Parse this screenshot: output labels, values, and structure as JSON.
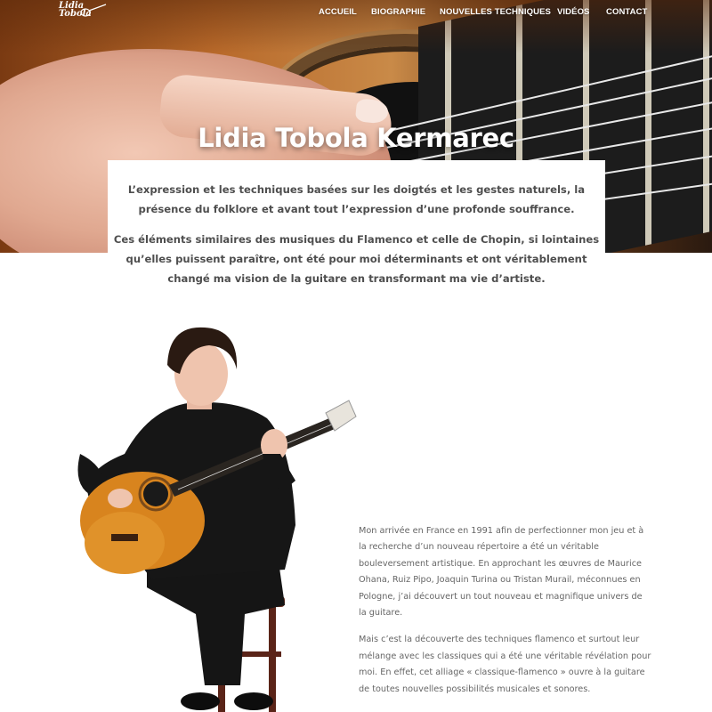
{
  "logo": {
    "line1": "Lidia",
    "line2": "Tobola"
  },
  "nav": {
    "items": [
      {
        "label": "ACCUEIL"
      },
      {
        "label": "BIOGRAPHIE"
      },
      {
        "label": "NOUVELLES TECHNIQUES"
      },
      {
        "label": "VIDÉOS"
      },
      {
        "label": "CONTACT"
      }
    ]
  },
  "hero": {
    "title": "Lidia Tobola Kermarec"
  },
  "intro": {
    "p1": "L’expression et les techniques basées sur les doigtés et les gestes naturels, la présence du folklore et avant tout l’expression d’une profonde souffrance.",
    "p2": "Ces éléments similaires des musiques du Flamenco et celle de Chopin, si lointaines qu’elles puissent paraître, ont été pour moi déterminants et ont véritablement changé ma vision de la guitare en transformant ma vie d’artiste."
  },
  "body": {
    "p1": "Mon arrivée en France en 1991 afin de perfectionner mon jeu et à la recherche d’un nouveau répertoire a été un véritable bouleversement artistique. En approchant les œuvres de Maurice Ohana, Ruiz Pipo, Joaquin Turina ou Tristan Murail, méconnues en Pologne, j’ai découvert un tout nouveau et magnifique univers de la guitare.",
    "p2": "Mais c’est la découverte des techniques flamenco et surtout leur mélange avec les classiques qui a été une véritable révélation pour moi. En effet, cet alliage « classique-flamenco » ouvre à la guitare de toutes nouvelles possibilités musicales et sonores."
  },
  "colors": {
    "text": "#4e4e4e",
    "body_text": "#666666",
    "nav_text": "#ffffff"
  }
}
